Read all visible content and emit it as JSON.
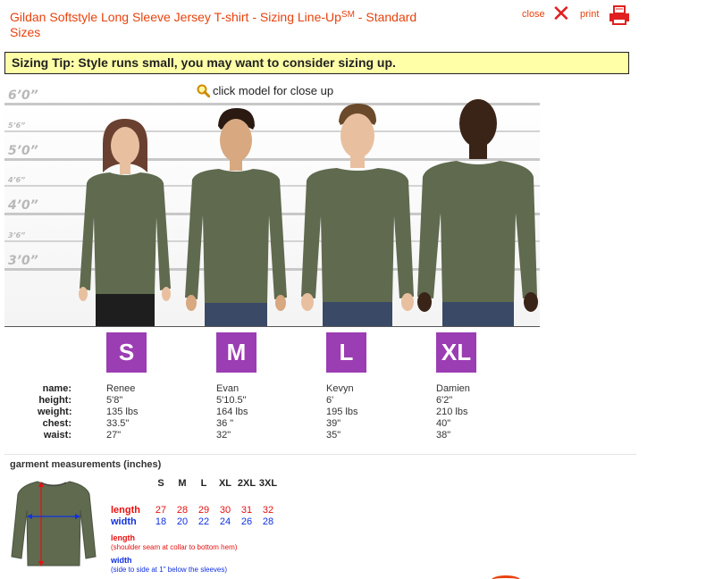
{
  "header": {
    "title": "Gildan Softstyle Long Sleeve Jersey T-shirt - Sizing Line-Up",
    "title_sup": "SM",
    "title_suffix": " - Standard Sizes",
    "close_label": "close",
    "print_label": "print"
  },
  "tip": "Sizing Tip: Style runs small, you may want to consider sizing up.",
  "zoom_hint": "click model for close up",
  "height_marks": [
    {
      "label": "6’0”",
      "kind": "major"
    },
    {
      "label": "5’6”",
      "kind": "minor"
    },
    {
      "label": "5’0”",
      "kind": "major"
    },
    {
      "label": "4’6”",
      "kind": "minor"
    },
    {
      "label": "4’0”",
      "kind": "major"
    },
    {
      "label": "3’6”",
      "kind": "minor"
    },
    {
      "label": "3’0”",
      "kind": "major"
    }
  ],
  "attribute_labels": {
    "name": "name:",
    "height": "height:",
    "weight": "weight:",
    "chest": "chest:",
    "waist": "waist:"
  },
  "models": [
    {
      "size": "S",
      "name": "Renee",
      "height": "5'8\"",
      "weight": "135 lbs",
      "chest": "33.5\"",
      "waist": "27\""
    },
    {
      "size": "M",
      "name": "Evan",
      "height": "5'10.5\"",
      "weight": "164 lbs",
      "chest": "36 \"",
      "waist": "32\""
    },
    {
      "size": "L",
      "name": "Kevyn",
      "height": "6'",
      "weight": "195 lbs",
      "chest": "39\"",
      "waist": "35\""
    },
    {
      "size": "XL",
      "name": "Damien",
      "height": "6'2\"",
      "weight": "210 lbs",
      "chest": "40\"",
      "waist": "38\""
    }
  ],
  "garment": {
    "title": "garment measurements (inches)",
    "sizes": [
      "S",
      "M",
      "L",
      "XL",
      "2XL",
      "3XL"
    ],
    "length_label": "length",
    "length": [
      "27",
      "28",
      "29",
      "30",
      "31",
      "32"
    ],
    "width_label": "width",
    "width": [
      "18",
      "20",
      "22",
      "24",
      "26",
      "28"
    ],
    "length_note_title": "length",
    "length_note": "(shoulder seam at collar to bottom hem)",
    "width_note_title": "width",
    "width_note": "(side to side at 1\" below the sleeves)"
  },
  "colors": {
    "accent": "#e8420d",
    "badge": "#9b3db3",
    "tip_bg": "#ffffa8",
    "shirt": "#5f6a4f",
    "length_color": "#e81010",
    "width_color": "#1030e0"
  }
}
